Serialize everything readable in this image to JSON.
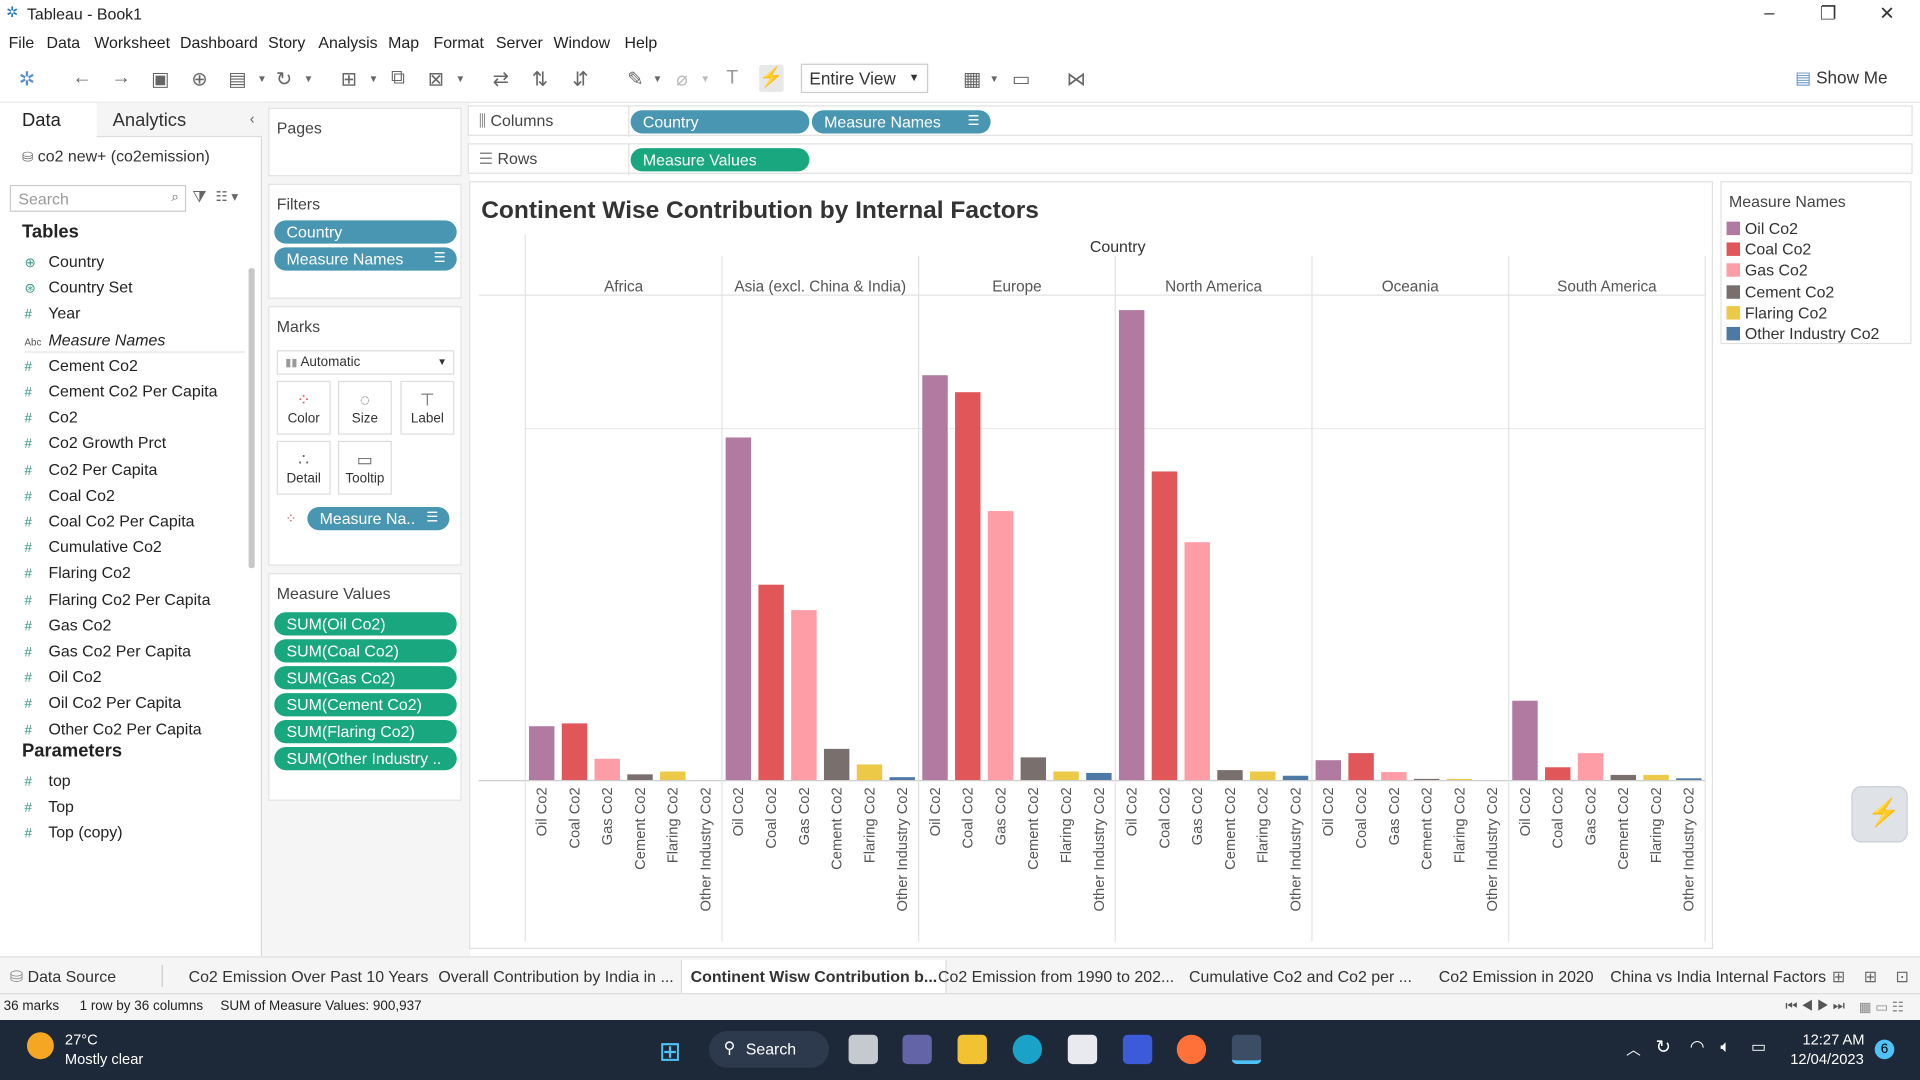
{
  "window": {
    "title": "Tableau - Book1"
  },
  "menu": [
    "File",
    "Data",
    "Worksheet",
    "Dashboard",
    "Story",
    "Analysis",
    "Map",
    "Format",
    "Server",
    "Window",
    "Help"
  ],
  "toolbar": {
    "fit": "Entire View",
    "show_me": "Show Me"
  },
  "left_pane": {
    "tab_data": "Data",
    "tab_analytics": "Analytics",
    "data_source": "co2 new+ (co2emission)",
    "search_placeholder": "Search",
    "tables_header": "Tables",
    "fields": [
      {
        "icon": "globe-icon",
        "label": "Country"
      },
      {
        "icon": "set-icon",
        "label": "Country Set"
      },
      {
        "icon": "hash-icon",
        "label": "Year"
      },
      {
        "icon": "abc-icon",
        "label": "Measure Names"
      },
      {
        "icon": "hash-icon",
        "label": "Cement Co2"
      },
      {
        "icon": "hash-icon",
        "label": "Cement Co2 Per Capita"
      },
      {
        "icon": "hash-icon",
        "label": "Co2"
      },
      {
        "icon": "hash-icon",
        "label": "Co2 Growth Prct"
      },
      {
        "icon": "hash-icon",
        "label": "Co2 Per Capita"
      },
      {
        "icon": "hash-icon",
        "label": "Coal Co2"
      },
      {
        "icon": "hash-icon",
        "label": "Coal Co2 Per Capita"
      },
      {
        "icon": "hash-icon",
        "label": "Cumulative Co2"
      },
      {
        "icon": "hash-icon",
        "label": "Flaring Co2"
      },
      {
        "icon": "hash-icon",
        "label": "Flaring Co2 Per Capita"
      },
      {
        "icon": "hash-icon",
        "label": "Gas Co2"
      },
      {
        "icon": "hash-icon",
        "label": "Gas Co2 Per Capita"
      },
      {
        "icon": "hash-icon",
        "label": "Oil Co2"
      },
      {
        "icon": "hash-icon",
        "label": "Oil Co2 Per Capita"
      },
      {
        "icon": "hash-icon",
        "label": "Other Co2 Per Capita"
      }
    ],
    "parameters_header": "Parameters",
    "parameters": [
      "top",
      "Top",
      "Top (copy)"
    ]
  },
  "cards": {
    "pages": "Pages",
    "filters": "Filters",
    "filter_pills": [
      "Country",
      "Measure Names"
    ],
    "marks": "Marks",
    "mark_type": "Automatic",
    "mark_buttons": [
      "Color",
      "Size",
      "Label",
      "Detail",
      "Tooltip"
    ],
    "marks_pill": "Measure Na..",
    "measure_values": "Measure Values",
    "measure_pills": [
      "SUM(Oil Co2)",
      "SUM(Coal Co2)",
      "SUM(Gas Co2)",
      "SUM(Cement Co2)",
      "SUM(Flaring Co2)",
      "SUM(Other Industry .."
    ]
  },
  "shelves": {
    "columns_label": "Columns",
    "rows_label": "Rows",
    "columns_pills": [
      "Country",
      "Measure Names"
    ],
    "rows_pills": [
      "Measure Values"
    ]
  },
  "legend": {
    "title": "Measure Names",
    "items": [
      {
        "label": "Oil Co2",
        "color": "#b07aa1"
      },
      {
        "label": "Coal Co2",
        "color": "#e15759"
      },
      {
        "label": "Gas Co2",
        "color": "#ff9da7"
      },
      {
        "label": "Cement Co2",
        "color": "#79706e"
      },
      {
        "label": "Flaring Co2",
        "color": "#edc948"
      },
      {
        "label": "Other Industry Co2",
        "color": "#4e79a7"
      }
    ]
  },
  "chart_data": {
    "type": "bar",
    "title": "Continent Wise Contribution by Internal Factors",
    "column_header": "Country",
    "grid": true,
    "categories": [
      "Africa",
      "Asia (excl. China & India)",
      "Europe",
      "North America",
      "Oceania",
      "South America"
    ],
    "measures": [
      "Oil Co2",
      "Coal Co2",
      "Gas Co2",
      "Cement Co2",
      "Flaring Co2",
      "Other Industry Co2"
    ],
    "series": [
      {
        "name": "Oil Co2",
        "color": "#b07aa1",
        "values": [
          19,
          121,
          143,
          166,
          7,
          28
        ]
      },
      {
        "name": "Coal Co2",
        "color": "#e15759",
        "values": [
          20,
          69,
          137,
          109,
          9.5,
          4.5
        ]
      },
      {
        "name": "Gas Co2",
        "color": "#ff9da7",
        "values": [
          7.5,
          60,
          95,
          84,
          2.8,
          9.5
        ]
      },
      {
        "name": "Cement Co2",
        "color": "#79706e",
        "values": [
          2,
          11,
          8,
          3.5,
          0.4,
          1.8
        ]
      },
      {
        "name": "Flaring Co2",
        "color": "#edc948",
        "values": [
          3,
          5.5,
          3,
          3,
          0.4,
          1.8
        ]
      },
      {
        "name": "Other Industry Co2",
        "color": "#4e79a7",
        "values": [
          0,
          1,
          2.5,
          1.5,
          0,
          0.6
        ]
      }
    ]
  },
  "sheet_tabs": {
    "data_source": "Data Source",
    "tabs": [
      "Co2 Emission Over Past 10 Years",
      "Overall Contribution by India in ...",
      "Continent Wisw Contribution b...",
      "Co2 Emission from 1990 to 202...",
      "Cumulative Co2 and Co2 per ...",
      "Co2 Emission in 2020",
      "China vs India Internal Factors"
    ],
    "active_index": 2
  },
  "status": {
    "marks": "36 marks",
    "dims": "1 row by 36 columns",
    "sum": "SUM of Measure Values: 900,937"
  },
  "taskbar": {
    "temp": "27°C",
    "weather": "Mostly clear",
    "search": "Search",
    "time": "12:27 AM",
    "date": "12/04/2023",
    "notifications": "6"
  }
}
